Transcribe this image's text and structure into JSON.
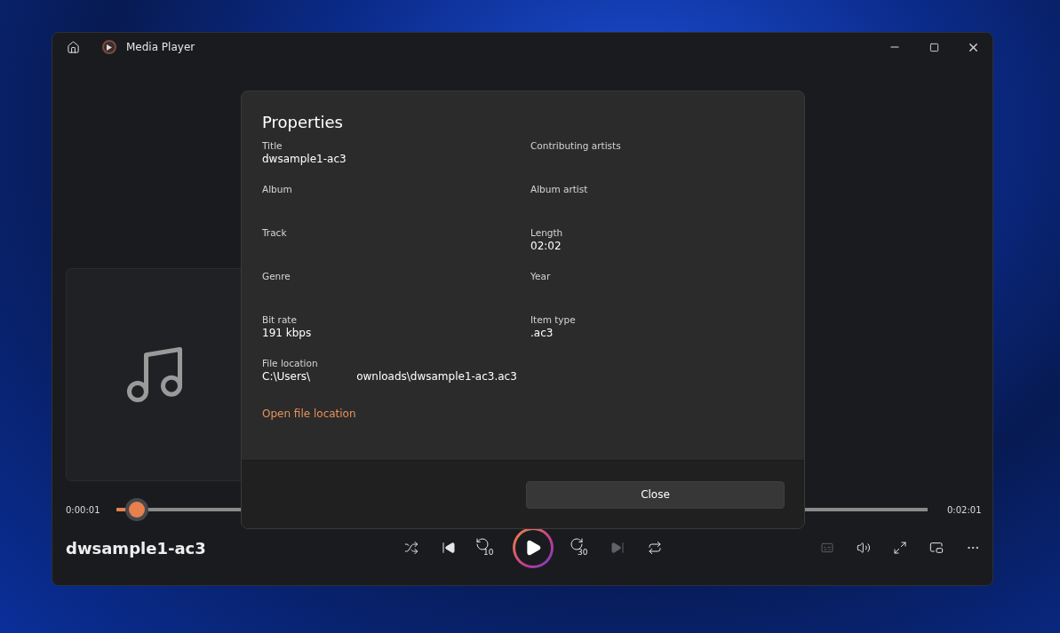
{
  "window": {
    "title": "Media Player"
  },
  "player": {
    "track_title": "dwsample1-ac3",
    "elapsed": "0:00:01",
    "duration": "0:02:01",
    "level": 0.025,
    "controls": [
      {
        "kind": "shuffle",
        "disabled": false
      },
      {
        "kind": "previous",
        "disabled": false
      },
      {
        "kind": "rewind",
        "label": "10",
        "disabled": false
      },
      {
        "kind": "play"
      },
      {
        "kind": "forward",
        "label": "30",
        "disabled": false
      },
      {
        "kind": "next",
        "disabled": true
      },
      {
        "kind": "repeat",
        "disabled": false
      }
    ],
    "extras": [
      {
        "kind": "captions",
        "disabled": true
      },
      {
        "kind": "volume",
        "disabled": false
      },
      {
        "kind": "fullscreen",
        "disabled": false
      },
      {
        "kind": "miniplayer",
        "disabled": false
      },
      {
        "kind": "more",
        "disabled": false
      }
    ]
  },
  "dialog": {
    "title": "Properties",
    "fields": [
      {
        "label": "Title",
        "value": "dwsample1-ac3"
      },
      {
        "label": "Contributing artists"
      },
      {
        "label": "Album"
      },
      {
        "label": "Album artist"
      },
      {
        "label": "Track"
      },
      {
        "label": "Length",
        "value": "02:02"
      },
      {
        "label": "Genre"
      },
      {
        "label": "Year"
      },
      {
        "label": "Bit rate",
        "value": "191 kbps"
      },
      {
        "label": "Item type",
        "value": ".ac3"
      }
    ],
    "file_location": {
      "label": "File location",
      "path_start": "C:\\Users\\",
      "path_end": "ownloads\\dwsample1-ac3.ac3"
    },
    "link": "Open file location",
    "close_button": "Close"
  }
}
